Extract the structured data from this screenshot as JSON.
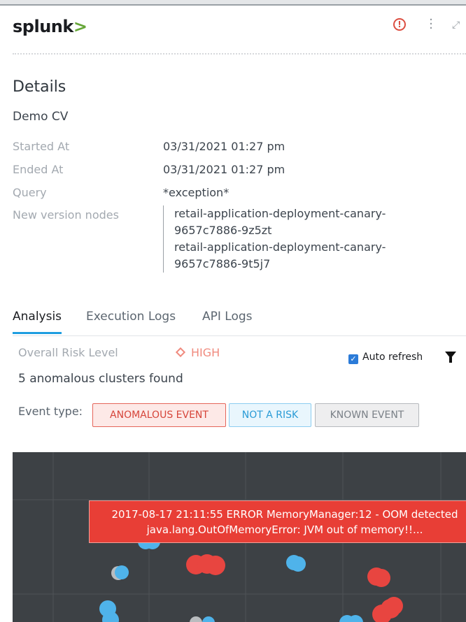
{
  "header": {
    "logo_text": "splunk",
    "logo_chevron": ">",
    "icons": [
      "alert-circle-icon",
      "more-vertical-icon",
      "expand-icon"
    ]
  },
  "details": {
    "title": "Details",
    "name": "Demo CV",
    "started_label": "Started At",
    "started_value": "03/31/2021 01:27 pm",
    "ended_label": "Ended At",
    "ended_value": "03/31/2021 01:27 pm",
    "query_label": "Query",
    "query_value": "*exception*",
    "nodes_label": "New version nodes",
    "nodes": [
      "retail-application-deployment-canary-",
      "9657c7886-9z5zt",
      "retail-application-deployment-canary-",
      "9657c7886-9t5j7"
    ]
  },
  "tabs": [
    {
      "label": "Analysis",
      "active": true
    },
    {
      "label": "Execution Logs",
      "active": false
    },
    {
      "label": "API Logs",
      "active": false
    }
  ],
  "analysis": {
    "risk_label": "Overall Risk Level",
    "risk_value": "HIGH",
    "auto_refresh_label": "Auto refresh",
    "auto_refresh_checked": true,
    "clusters_text": "5 anomalous clusters found",
    "event_type_label": "Event type:",
    "event_buttons": [
      "ANOMALOUS EVENT",
      "NOT A RISK",
      "KNOWN EVENT"
    ]
  },
  "chart_data": {
    "type": "scatter",
    "tooltip_line1": "2017-08-17 21:11:55 ERROR MemoryManager:12 - OOM detected",
    "tooltip_line2": "java.lang.OutOfMemoryError: JVM out of memory!!...",
    "series": [
      {
        "name": "ANOMALOUS EVENT",
        "color": "#e84540"
      },
      {
        "name": "NOT A RISK",
        "color": "#4fb3ea"
      },
      {
        "name": "KNOWN EVENT",
        "color": "#b9bcbf"
      }
    ]
  },
  "colors": {
    "accent": "#1e9ee0",
    "risk_high": "#f08a7e",
    "chart_bg": "#3d4145"
  }
}
